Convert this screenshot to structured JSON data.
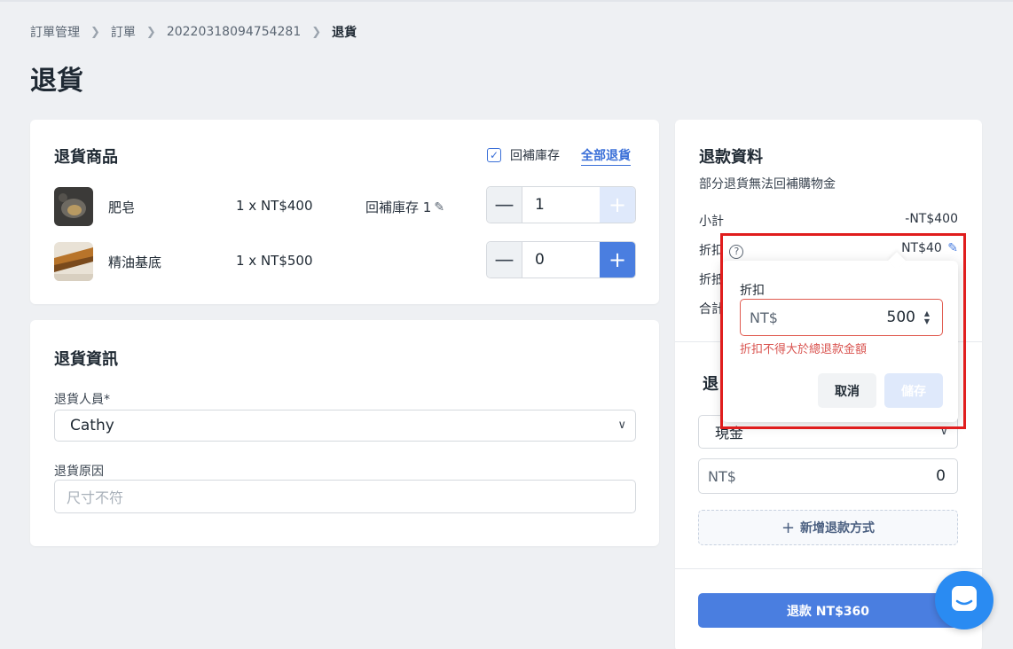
{
  "breadcrumb": {
    "items": [
      "訂單管理",
      "訂單",
      "20220318094754281"
    ],
    "current": "退貨"
  },
  "page_title": "退貨",
  "items_card": {
    "title": "退貨商品",
    "restock_label": "回補庫存",
    "restock_checked": true,
    "return_all_label": "全部退貨",
    "items": [
      {
        "name": "肥皂",
        "price": "1 x NT$400",
        "restock": "回補庫存 1",
        "qty": "1",
        "plus_enabled": false
      },
      {
        "name": "精油基底",
        "price": "1 x NT$500",
        "restock": "",
        "qty": "0",
        "plus_enabled": true
      }
    ]
  },
  "info_card": {
    "title": "退貨資訊",
    "staff_label": "退貨人員*",
    "staff_value": "Cathy",
    "reason_label": "退貨原因",
    "reason_placeholder": "尺寸不符"
  },
  "refund_card": {
    "title": "退款資料",
    "subtitle": "部分退貨無法回補購物金",
    "subtotal_label": "小計",
    "subtotal_value": "-NT$400",
    "discount_label": "折扣",
    "discount_value": "NT$40",
    "row3_label": "折抵",
    "total_label": "合計",
    "method_title": "退",
    "method_value": "現金",
    "amount_prefix": "NT$",
    "amount_value": "0",
    "add_method_label": "新增退款方式",
    "refund_button": "退款 NT$360"
  },
  "discount_popover": {
    "label": "折扣",
    "prefix": "NT$",
    "value": "500",
    "error": "折扣不得大於總退款金額",
    "cancel": "取消",
    "save": "儲存"
  },
  "colors": {
    "accent": "#4a7ee0",
    "error": "#d9534f",
    "highlight": "#e01d1d"
  }
}
